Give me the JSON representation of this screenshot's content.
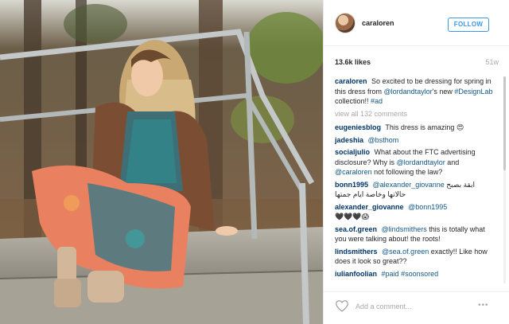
{
  "post": {
    "username": "caraloren",
    "follow_label": "FOLLOW",
    "likes": "13.6k likes",
    "time": "51w"
  },
  "caption": {
    "user": "caraloren",
    "text1": "So excited to be dressing for spring in this dress from ",
    "mention": "@lordandtaylor",
    "text2": "'s new ",
    "hashtag1": "#DesignLab",
    "text3": " collection!! ",
    "hashtag2": "#ad"
  },
  "view_all": "view all 132 comments",
  "comments": [
    {
      "user": "eugeniesblog",
      "text": "This dress is amazing 😍"
    },
    {
      "user": "jadeshia",
      "mention": "@bsthom"
    },
    {
      "user": "socialjulio",
      "text": "What about the FTC advertising disclosure? Why is ",
      "mention1": "@lordandtaylor",
      "text2": " and ",
      "mention2": "@caraloren",
      "text3": " not following the law?"
    },
    {
      "user": "bonn1995",
      "mention": "@alexander_giovanne",
      "text": "ابقة بصبح حالاتها وخاصة ايام جمتها"
    },
    {
      "user": "alexander_giovanne",
      "mention": "@bonn1995",
      "text": "🖤🖤🖤😱"
    },
    {
      "user": "sea.of.green",
      "mention": "@lindsmithers",
      "text": " this is totally what you were talking about! the roots!"
    },
    {
      "user": "lindsmithers",
      "mention": "@sea.of.green",
      "text": " exactly!! Like how does it look so great??"
    },
    {
      "user": "iulianfoolian",
      "hashtag1": "#paid",
      "hashtag2": "#soonsored"
    }
  ],
  "footer": {
    "placeholder": "Add a comment...",
    "more": "•••"
  },
  "colors": {
    "link": "#125688",
    "username": "#003569",
    "follow": "#3897f0",
    "muted": "#a8a8a8"
  },
  "icons": {
    "heart": "heart-icon",
    "more": "more-icon"
  }
}
